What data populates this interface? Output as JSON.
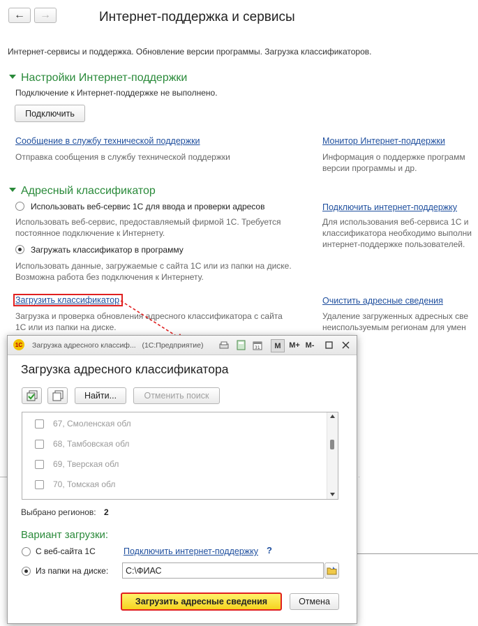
{
  "window": {
    "title": "Интернет-поддержка и сервисы",
    "subtitle": "Интернет-сервисы и поддержка. Обновление версии программы. Загрузка классификаторов."
  },
  "support": {
    "section_title": "Настройки Интернет-поддержки",
    "status": "Подключение к Интернет-поддержке не выполнено.",
    "connect_button": "Подключить",
    "message_link": "Сообщение в службу технической поддержки",
    "message_desc": "Отправка сообщения в службу технической поддержки",
    "monitor_link": "Монитор Интернет-поддержки",
    "monitor_desc_1": "Информация о поддержке программ",
    "monitor_desc_2": "версии программы и др."
  },
  "address": {
    "section_title": "Адресный классификатор",
    "option_web": "Использовать веб-сервис 1С для ввода и проверки адресов",
    "option_web_desc_1": "Использовать веб-сервис, предоставляемый фирмой 1С. Требуется",
    "option_web_desc_2": "постоянное подключение к Интернету.",
    "option_load": "Загружать классификатор в программу",
    "option_load_desc_1": "Использовать данные, загружаемые с сайта 1С или из папки на диске.",
    "option_load_desc_2": "Возможна работа без подключения к Интернету.",
    "connect_link": "Подключить интернет-поддержку",
    "connect_desc_1": "Для использования веб-сервиса 1С и",
    "connect_desc_2": "классификатора необходимо выполни",
    "connect_desc_3": "интернет-поддержке пользователей.",
    "load_link": "Загрузить классификатор",
    "load_desc_1": "Загрузка и проверка обновления адресного классификатора с сайта",
    "load_desc_2": "1С или из папки на диске.",
    "clear_link": "Очистить адресные сведения",
    "clear_desc_1": "Удаление загруженных адресных све",
    "clear_desc_2": "неиспользуемым регионам для умен"
  },
  "dialog": {
    "titlebar_text": "Загрузка адресного классиф...   (1С:Предприятие)",
    "heading": "Загрузка адресного классификатора",
    "find_button": "Найти...",
    "cancel_search_button": "Отменить поиск",
    "regions": [
      "67, Смоленская обл",
      "68, Тамбовская обл",
      "69, Тверская обл",
      "70, Томская обл"
    ],
    "selected_label": "Выбрано регионов:",
    "selected_count": "2",
    "variant_title": "Вариант загрузки:",
    "from_site": "С веб-сайта 1С",
    "connect_link": "Подключить интернет-поддержку",
    "help": "?",
    "from_folder": "Из папки на диске:",
    "folder_path": "C:\\ФИАС",
    "load_button": "Загрузить адресные сведения",
    "cancel_button": "Отмена",
    "tb_m": "M",
    "tb_mplus": "M+",
    "tb_mminus": "M-"
  },
  "colors": {
    "section_green": "#2a8a3a",
    "link_blue": "#1f4f9e",
    "highlight_red": "#e02020",
    "load_button_yellow": "#ffe23a"
  }
}
